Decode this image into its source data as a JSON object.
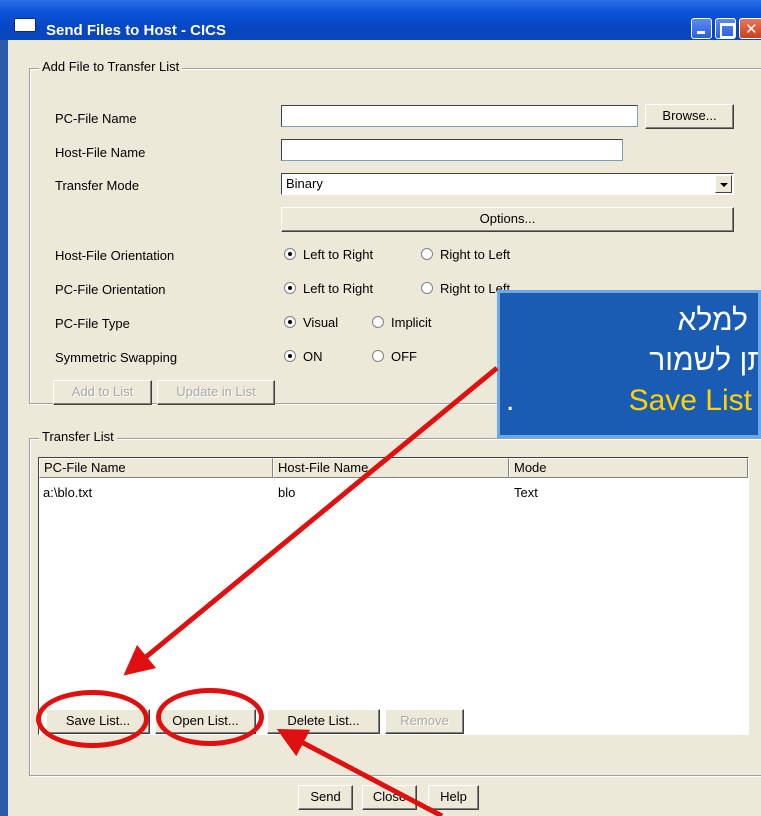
{
  "window": {
    "title": "Send Files to Host - CICS"
  },
  "add_group": {
    "label": "Add File to Transfer List",
    "pc_file_label": "PC-File Name",
    "pc_file_value": "",
    "browse": "Browse...",
    "host_file_label": "Host-File Name",
    "host_file_value": "",
    "transfer_mode_label": "Transfer Mode",
    "transfer_mode_value": "Binary",
    "options": "Options...",
    "host_orientation_label": "Host-File Orientation",
    "host_orientation": {
      "opt1": "Left to Right",
      "opt2": "Right to Left",
      "selected": "Left to Right"
    },
    "pc_orientation_label": "PC-File Orientation",
    "pc_orientation": {
      "opt1": "Left to Right",
      "opt2": "Right to Left",
      "selected": "Left to Right"
    },
    "pc_type_label": "PC-File Type",
    "pc_type": {
      "opt1": "Visual",
      "opt2": "Implicit",
      "selected": "Visual"
    },
    "swap_label": "Symmetric Swapping",
    "swap": {
      "opt1": "ON",
      "opt2": "OFF",
      "selected": "ON"
    },
    "add_to_list": "Add to List",
    "update_in_list": "Update in List"
  },
  "transfer_group": {
    "label": "Transfer List",
    "columns": [
      "PC-File Name",
      "Host-File Name",
      "Mode"
    ],
    "rows": [
      {
        "pc": "a:\\blo.txt",
        "host": "blo",
        "mode": "Text"
      }
    ],
    "save_list": "Save List...",
    "open_list": "Open List...",
    "delete_list": "Delete List...",
    "remove": "Remove"
  },
  "footer": {
    "send": "Send",
    "close": "Close",
    "help": "Help"
  },
  "callout": {
    "line1": "ן למלא",
    "line2": "תן לשמור",
    "line3_highlight": "Save List",
    "line3_tail": "."
  },
  "colors": {
    "annotation_red": "#e01010",
    "callout_bg": "#1a5cb4",
    "callout_highlight": "#ffd200"
  }
}
